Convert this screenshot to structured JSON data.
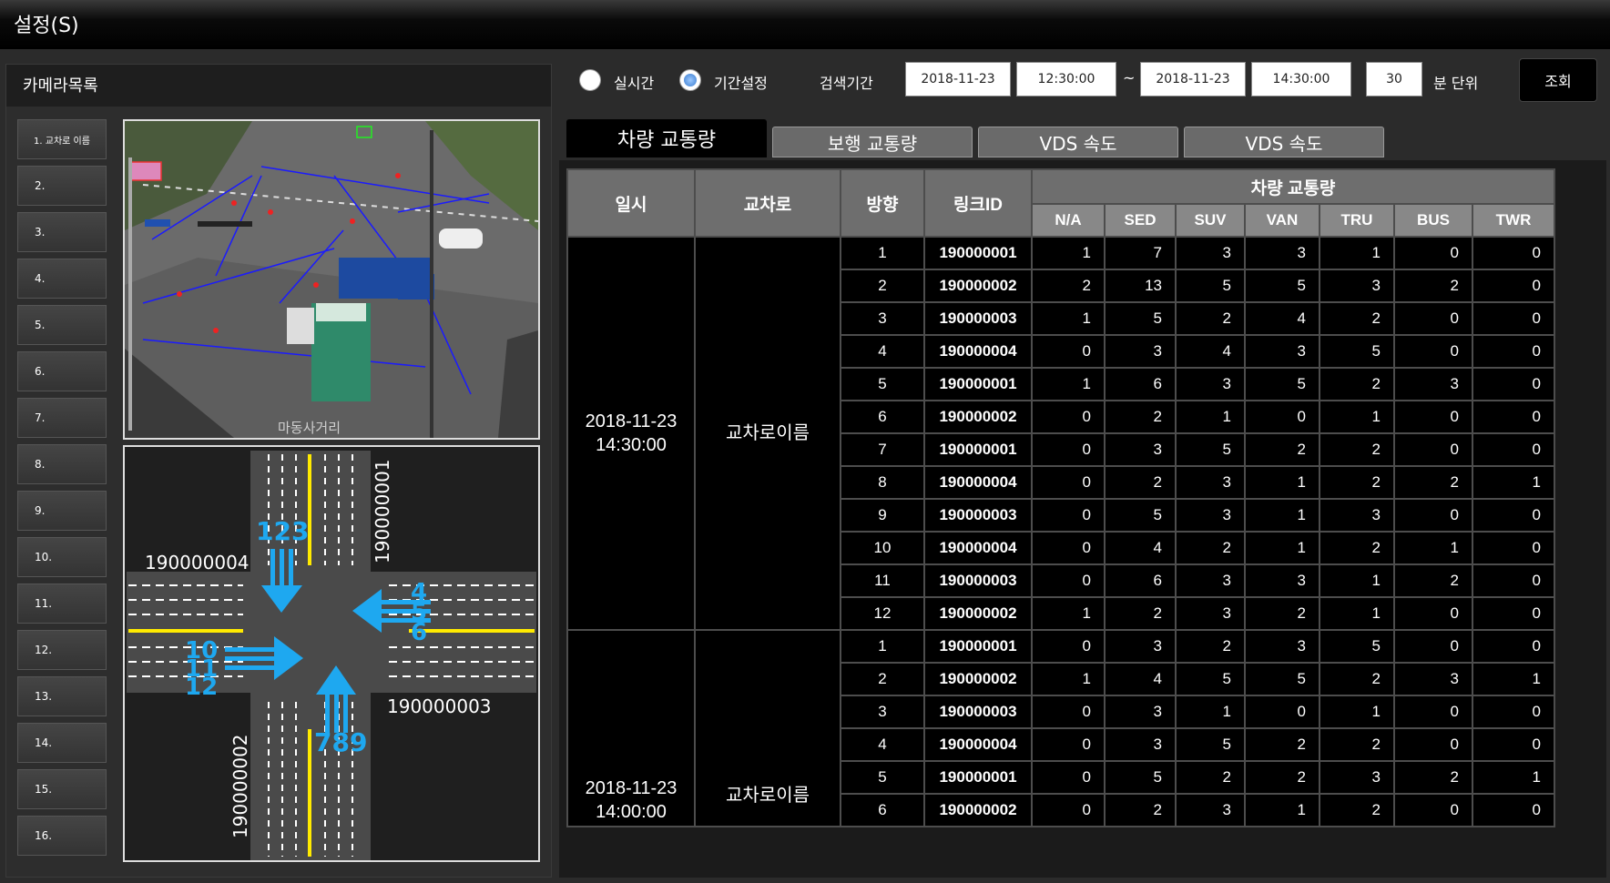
{
  "window": {
    "title": "설정(S)"
  },
  "camera_panel": {
    "title": "카메라목록",
    "items": [
      "1. 교차로 이름",
      "2.",
      "3.",
      "4.",
      "5.",
      "6.",
      "7.",
      "8.",
      "9.",
      "10.",
      "11.",
      "12.",
      "13.",
      "14.",
      "15.",
      "16."
    ],
    "camera_overlay_text": "마동사거리",
    "map": {
      "link_top": "190000001",
      "link_left": "190000004",
      "link_right": "190000003",
      "link_bottom": "190000002",
      "dir_north": "123",
      "dir_east": [
        "4",
        "5",
        "6"
      ],
      "dir_west": [
        "10",
        "11",
        "12"
      ],
      "dir_south": "789"
    }
  },
  "controls": {
    "radio_realtime": "실시간",
    "radio_period": "기간설정",
    "search_period_label": "검색기간",
    "start_date": "2018-11-23",
    "start_time": "12:30:00",
    "tilde": "~",
    "end_date": "2018-11-23",
    "end_time": "14:30:00",
    "interval": "30",
    "interval_unit": "분 단위",
    "query_button": "조회"
  },
  "tabs": [
    "차량 교통량",
    "보행 교통량",
    "VDS 속도",
    "VDS 속도"
  ],
  "table": {
    "headers": {
      "datetime": "일시",
      "intersection": "교차로",
      "direction": "방향",
      "link_id": "링크ID",
      "group": "차량 교통량",
      "types": [
        "N/A",
        "SED",
        "SUV",
        "VAN",
        "TRU",
        "BUS",
        "TWR"
      ]
    },
    "groups": [
      {
        "date": "2018-11-23",
        "time": "14:30:00",
        "intersection": "교차로이름",
        "rows": [
          [
            "1",
            "190000001",
            "1",
            "7",
            "3",
            "3",
            "1",
            "0",
            "0"
          ],
          [
            "2",
            "190000002",
            "2",
            "13",
            "5",
            "5",
            "3",
            "2",
            "0"
          ],
          [
            "3",
            "190000003",
            "1",
            "5",
            "2",
            "4",
            "2",
            "0",
            "0"
          ],
          [
            "4",
            "190000004",
            "0",
            "3",
            "4",
            "3",
            "5",
            "0",
            "0"
          ],
          [
            "5",
            "190000001",
            "1",
            "6",
            "3",
            "5",
            "2",
            "3",
            "0"
          ],
          [
            "6",
            "190000002",
            "0",
            "2",
            "1",
            "0",
            "1",
            "0",
            "0"
          ],
          [
            "7",
            "190000001",
            "0",
            "3",
            "5",
            "2",
            "2",
            "0",
            "0"
          ],
          [
            "8",
            "190000004",
            "0",
            "2",
            "3",
            "1",
            "2",
            "2",
            "1"
          ],
          [
            "9",
            "190000003",
            "0",
            "5",
            "3",
            "1",
            "3",
            "0",
            "0"
          ],
          [
            "10",
            "190000004",
            "0",
            "4",
            "2",
            "1",
            "2",
            "1",
            "0"
          ],
          [
            "11",
            "190000003",
            "0",
            "6",
            "3",
            "3",
            "1",
            "2",
            "0"
          ],
          [
            "12",
            "190000002",
            "1",
            "2",
            "3",
            "2",
            "1",
            "0",
            "0"
          ]
        ]
      },
      {
        "date": "2018-11-23",
        "time": "14:00:00",
        "intersection": "교차로이름",
        "rows": [
          [
            "1",
            "190000001",
            "0",
            "3",
            "2",
            "3",
            "5",
            "0",
            "0"
          ],
          [
            "2",
            "190000002",
            "1",
            "4",
            "5",
            "5",
            "2",
            "3",
            "1"
          ],
          [
            "3",
            "190000003",
            "0",
            "3",
            "1",
            "0",
            "1",
            "0",
            "0"
          ],
          [
            "4",
            "190000004",
            "0",
            "3",
            "5",
            "2",
            "2",
            "0",
            "0"
          ],
          [
            "5",
            "190000001",
            "0",
            "5",
            "2",
            "2",
            "3",
            "2",
            "1"
          ],
          [
            "6",
            "190000002",
            "0",
            "2",
            "3",
            "1",
            "2",
            "0",
            "0"
          ]
        ]
      }
    ]
  }
}
